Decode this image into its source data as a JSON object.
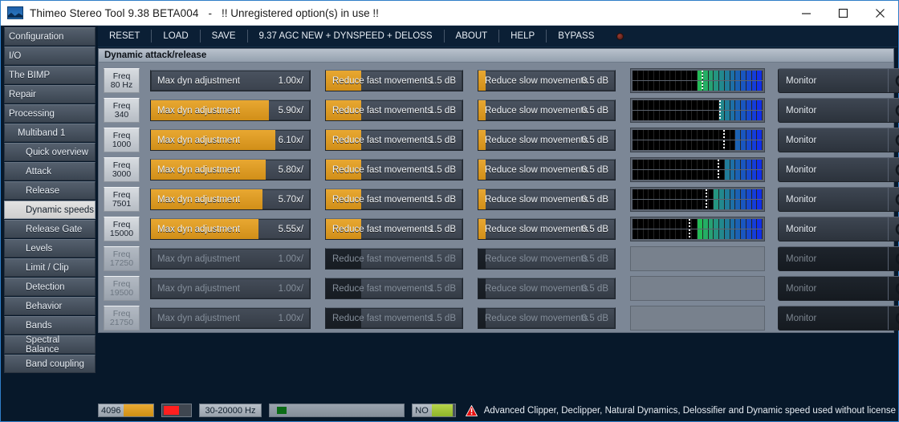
{
  "window": {
    "title": "Thimeo Stereo Tool 9.38 BETA004",
    "separator": "-",
    "warning": "!! Unregistered option(s) in use !!",
    "minimize": "minimize-icon",
    "maximize": "maximize-icon",
    "close": "close-icon"
  },
  "menubar": {
    "items": [
      {
        "label": "RESET"
      },
      {
        "label": "LOAD"
      },
      {
        "label": "SAVE"
      },
      {
        "label": "9.37 AGC NEW + DYNSPEED + DELOSS"
      },
      {
        "label": "ABOUT"
      },
      {
        "label": "HELP"
      },
      {
        "label": "BYPASS"
      }
    ]
  },
  "sidebar": {
    "items": [
      {
        "label": "Configuration",
        "level": 0,
        "active": false
      },
      {
        "label": "I/O",
        "level": 0,
        "active": false
      },
      {
        "label": "The BIMP",
        "level": 0,
        "active": false
      },
      {
        "label": "Repair",
        "level": 0,
        "active": false
      },
      {
        "label": "Processing",
        "level": 0,
        "active": false
      },
      {
        "label": "Multiband 1",
        "level": 1,
        "active": false
      },
      {
        "label": "Quick overview",
        "level": 2,
        "active": false
      },
      {
        "label": "Attack",
        "level": 2,
        "active": false
      },
      {
        "label": "Release",
        "level": 2,
        "active": false
      },
      {
        "label": "Dynamic speeds",
        "level": 2,
        "active": true
      },
      {
        "label": "Release Gate",
        "level": 2,
        "active": false
      },
      {
        "label": "Levels",
        "level": 2,
        "active": false
      },
      {
        "label": "Limit / Clip",
        "level": 2,
        "active": false
      },
      {
        "label": "Detection",
        "level": 2,
        "active": false
      },
      {
        "label": "Behavior",
        "level": 2,
        "active": false
      },
      {
        "label": "Bands",
        "level": 2,
        "active": false
      },
      {
        "label": "Spectral Balance",
        "level": 2,
        "active": false
      },
      {
        "label": "Band coupling",
        "level": 2,
        "active": false
      }
    ]
  },
  "panel": {
    "title": "Dynamic attack/release",
    "monitor_label": "Monitor",
    "rows": [
      {
        "freq_top": "Freq",
        "freq_bottom": "80 Hz",
        "enabled": true,
        "meter": true,
        "max": {
          "label": "Max dyn adjustment",
          "value": "1.00x/",
          "fill": 0
        },
        "fast": {
          "label": "Reduce fast movements",
          "value": "1.5 dB",
          "fill": 0.26
        },
        "slow": {
          "label": "Reduce slow movements",
          "value": "0.5 dB",
          "fill": 0.05
        },
        "meter_level": 0.52,
        "meter_peak": 0.47
      },
      {
        "freq_top": "Freq",
        "freq_bottom": "340",
        "enabled": true,
        "meter": true,
        "max": {
          "label": "Max dyn adjustment",
          "value": "5.90x/",
          "fill": 0.74
        },
        "fast": {
          "label": "Reduce fast movements",
          "value": "1.5 dB",
          "fill": 0.26
        },
        "slow": {
          "label": "Reduce slow movements",
          "value": "0.5 dB",
          "fill": 0.05
        },
        "meter_level": 0.335,
        "meter_peak": 0.335
      },
      {
        "freq_top": "Freq",
        "freq_bottom": "1000",
        "enabled": true,
        "meter": true,
        "max": {
          "label": "Max dyn adjustment",
          "value": "6.10x/",
          "fill": 0.785
        },
        "fast": {
          "label": "Reduce fast movements",
          "value": "1.5 dB",
          "fill": 0.26
        },
        "slow": {
          "label": "Reduce slow movements",
          "value": "0.5 dB",
          "fill": 0.05
        },
        "meter_level": 0.24,
        "meter_peak": 0.3
      },
      {
        "freq_top": "Freq",
        "freq_bottom": "3000",
        "enabled": true,
        "meter": true,
        "max": {
          "label": "Max dyn adjustment",
          "value": "5.80x/",
          "fill": 0.72
        },
        "fast": {
          "label": "Reduce fast movements",
          "value": "1.5 dB",
          "fill": 0.26
        },
        "slow": {
          "label": "Reduce slow movements",
          "value": "0.5 dB",
          "fill": 0.05
        },
        "meter_level": 0.3,
        "meter_peak": 0.345
      },
      {
        "freq_top": "Freq",
        "freq_bottom": "7501",
        "enabled": true,
        "meter": true,
        "max": {
          "label": "Max dyn adjustment",
          "value": "5.70x/",
          "fill": 0.7
        },
        "fast": {
          "label": "Reduce fast movements",
          "value": "1.5 dB",
          "fill": 0.26
        },
        "slow": {
          "label": "Reduce slow movements",
          "value": "0.5 dB",
          "fill": 0.05
        },
        "meter_level": 0.395,
        "meter_peak": 0.44
      },
      {
        "freq_top": "Freq",
        "freq_bottom": "15000",
        "enabled": true,
        "meter": true,
        "max": {
          "label": "Max dyn adjustment",
          "value": "5.55x/",
          "fill": 0.675
        },
        "fast": {
          "label": "Reduce fast movements",
          "value": "1.5 dB",
          "fill": 0.26
        },
        "slow": {
          "label": "Reduce slow movements",
          "value": "0.5 dB",
          "fill": 0.05
        },
        "meter_level": 0.515,
        "meter_peak": 0.565
      },
      {
        "freq_top": "Freq",
        "freq_bottom": "17250",
        "enabled": false,
        "meter": false,
        "max": {
          "label": "Max dyn adjustment",
          "value": "1.00x/",
          "fill": 0
        },
        "fast": {
          "label": "Reduce fast movements",
          "value": "1.5 dB",
          "fill": 0.26
        },
        "slow": {
          "label": "Reduce slow movements",
          "value": "0.5 dB",
          "fill": 0.05
        },
        "meter_level": 0,
        "meter_peak": 0
      },
      {
        "freq_top": "Freq",
        "freq_bottom": "19500",
        "enabled": false,
        "meter": false,
        "max": {
          "label": "Max dyn adjustment",
          "value": "1.00x/",
          "fill": 0
        },
        "fast": {
          "label": "Reduce fast movements",
          "value": "1.5 dB",
          "fill": 0.26
        },
        "slow": {
          "label": "Reduce slow movements",
          "value": "0.5 dB",
          "fill": 0.05
        },
        "meter_level": 0,
        "meter_peak": 0
      },
      {
        "freq_top": "Freq",
        "freq_bottom": "21750",
        "enabled": false,
        "meter": false,
        "max": {
          "label": "Max dyn adjustment",
          "value": "1.00x/",
          "fill": 0
        },
        "fast": {
          "label": "Reduce fast movements",
          "value": "1.5 dB",
          "fill": 0.26
        },
        "slow": {
          "label": "Reduce slow movements",
          "value": "0.5 dB",
          "fill": 0.05
        },
        "meter_level": 0,
        "meter_peak": 0
      }
    ]
  },
  "statusbar": {
    "level_value": "4096",
    "range": "30-20000 Hz",
    "no_label": "NO",
    "warning_icon": "warning-triangle-icon",
    "message": "Advanced Clipper, Declipper, Natural Dynamics, Delossifier and Dynamic speed used without license"
  },
  "colors": {
    "accent_orange": "#e0a02a",
    "panel_bg": "#7c8796",
    "app_bg": "#07182a",
    "title_blue": "#2f7ec8",
    "warn_red": "#ff1f1f"
  }
}
